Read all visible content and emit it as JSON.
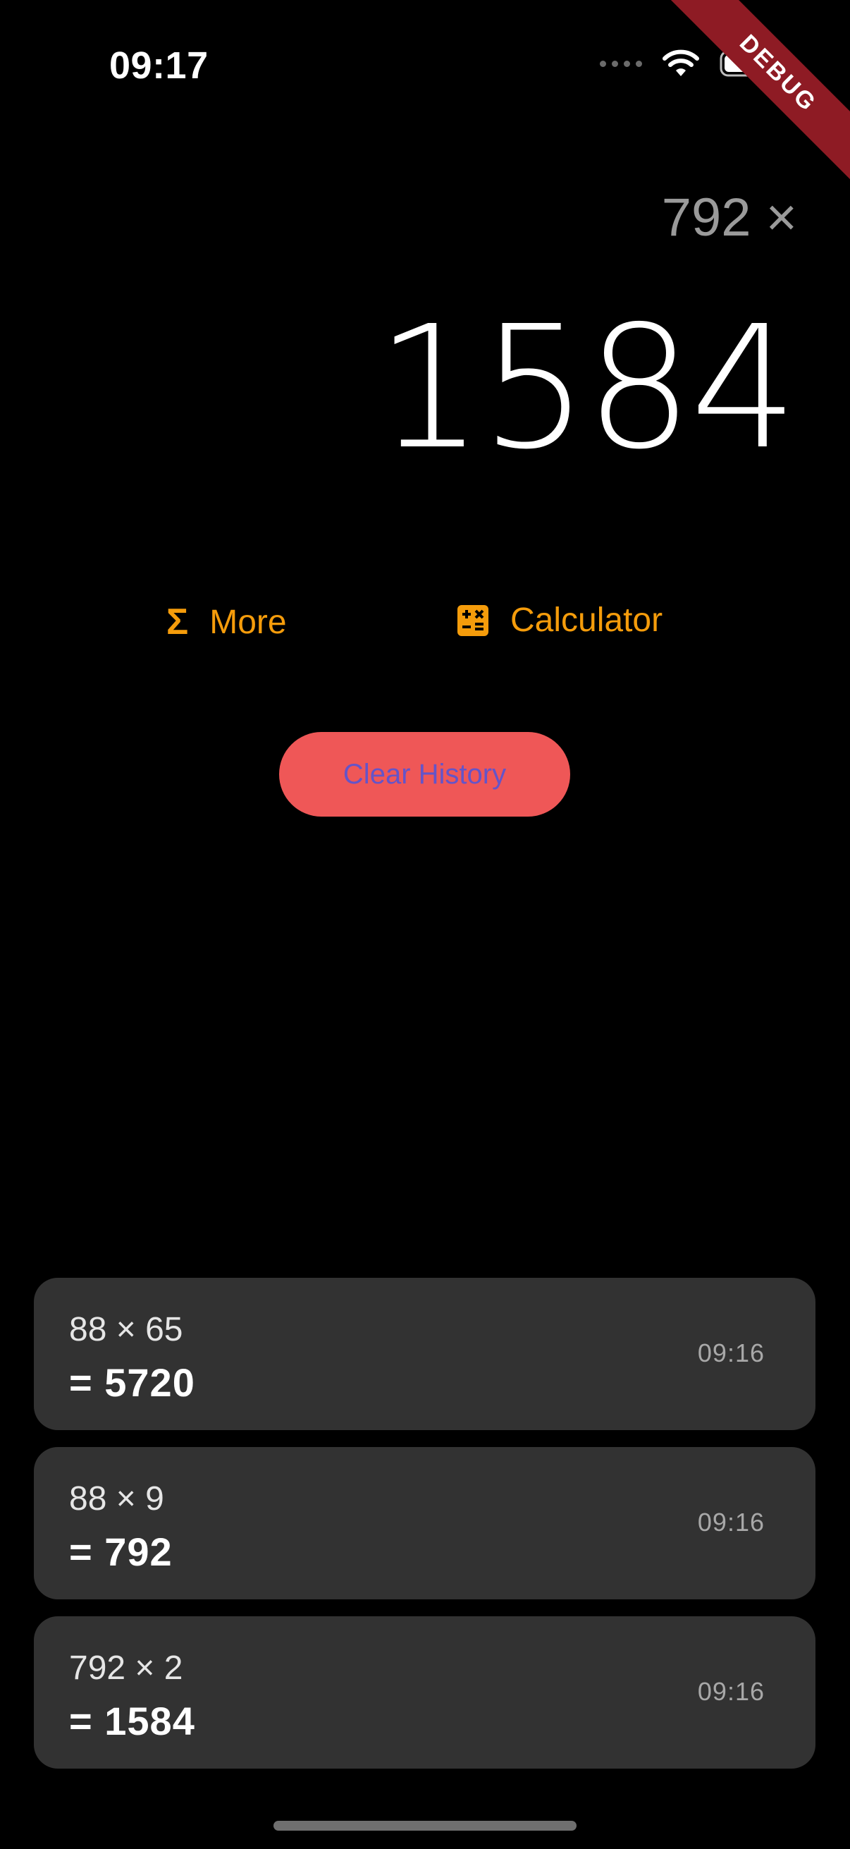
{
  "status": {
    "time": "09:17",
    "debug": "DEBUG"
  },
  "display": {
    "expression": "792 ×",
    "result": "1584"
  },
  "actions": {
    "more_label": "More",
    "more_icon": "Σ",
    "calculator_label": "Calculator"
  },
  "clear_history": {
    "label": "Clear History"
  },
  "history": [
    {
      "expression": "88 × 65",
      "result": "= 5720",
      "time": "09:16"
    },
    {
      "expression": "88 × 9",
      "result": "= 792",
      "time": "09:16"
    },
    {
      "expression": "792 × 2",
      "result": "= 1584",
      "time": "09:16"
    }
  ],
  "colors": {
    "accent": "#f59c0b",
    "clear_bg": "#ef5757",
    "clear_text": "#6454c9",
    "card_bg": "#323232"
  }
}
